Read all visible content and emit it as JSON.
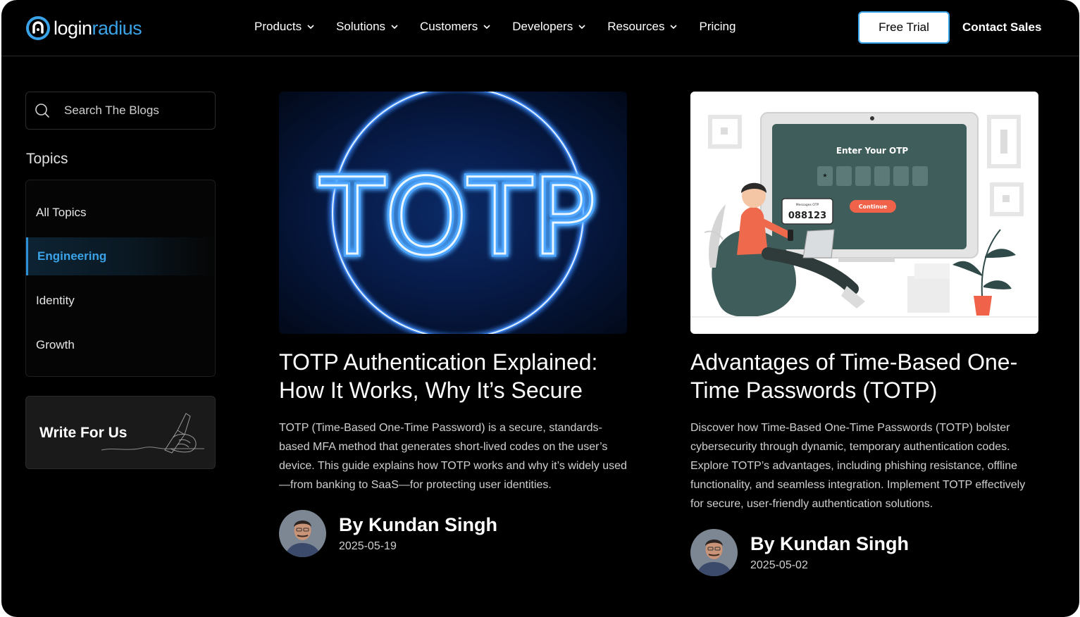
{
  "header": {
    "logo": {
      "part1": "login",
      "part2": "radius"
    },
    "nav": [
      {
        "label": "Products",
        "dropdown": true
      },
      {
        "label": "Solutions",
        "dropdown": true
      },
      {
        "label": "Customers",
        "dropdown": true
      },
      {
        "label": "Developers",
        "dropdown": true
      },
      {
        "label": "Resources",
        "dropdown": true
      },
      {
        "label": "Pricing",
        "dropdown": false
      }
    ],
    "free_trial": "Free Trial",
    "contact_sales": "Contact Sales"
  },
  "sidebar": {
    "search": {
      "placeholder": "Search The Blogs",
      "value": ""
    },
    "topics_title": "Topics",
    "topics": [
      {
        "label": "All Topics",
        "active": false
      },
      {
        "label": "Engineering",
        "active": true
      },
      {
        "label": "Identity",
        "active": false
      },
      {
        "label": "Growth",
        "active": false
      }
    ],
    "write_for_us": "Write For Us"
  },
  "posts": [
    {
      "image": {
        "icon": "neon-totp-sign-image",
        "text": "TOTP"
      },
      "title": "TOTP Authentication Explained: How It Works, Why It’s Secure",
      "description": "TOTP (Time-Based One-Time Password) is a secure, standards-based MFA method that generates short-lived codes on the user’s device. This guide explains how TOTP works and why it’s widely used—from banking to SaaS—for protecting user identities.",
      "author": "By Kundan Singh",
      "date": "2025-05-19"
    },
    {
      "image": {
        "icon": "otp-illustration-image",
        "screen_title": "Enter Your OTP",
        "message_label": "Messages OTP",
        "otp_code": "088123",
        "button": "Continue"
      },
      "title": "Advantages of Time-Based One-Time Passwords (TOTP)",
      "description": "Discover how Time-Based One-Time Passwords (TOTP) bolster cybersecurity through dynamic, temporary authentication codes. Explore TOTP’s advantages, including phishing resistance, offline functionality, and seamless integration. Implement TOTP effectively for secure, user-friendly authentication solutions.",
      "author": "By Kundan Singh",
      "date": "2025-05-02"
    }
  ],
  "colors": {
    "accent": "#3aa3e8",
    "background": "#000000"
  }
}
